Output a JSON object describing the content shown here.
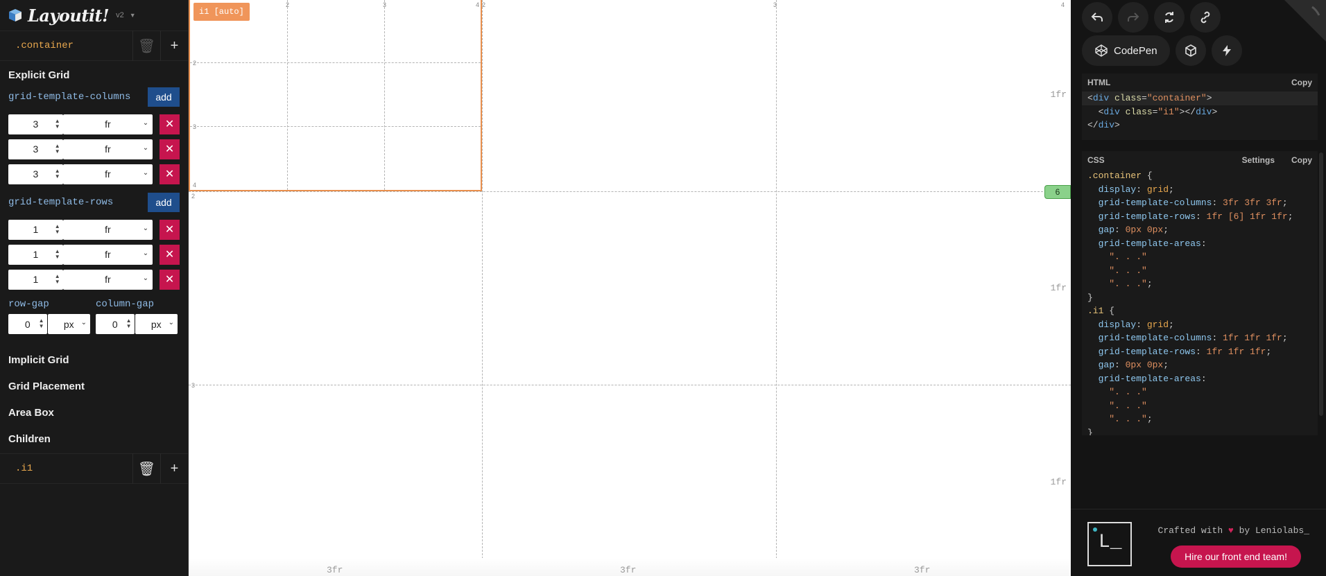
{
  "app": {
    "name": "Layoutit!",
    "version": "v2"
  },
  "sidebar": {
    "container_selector": ".container",
    "explicit_title": "Explicit Grid",
    "columns_label": "grid-template-columns",
    "rows_label": "grid-template-rows",
    "add_label": "add",
    "columns": [
      {
        "value": "3",
        "unit": "fr"
      },
      {
        "value": "3",
        "unit": "fr"
      },
      {
        "value": "3",
        "unit": "fr"
      }
    ],
    "rows": [
      {
        "value": "1",
        "unit": "fr"
      },
      {
        "value": "1",
        "unit": "fr"
      },
      {
        "value": "1",
        "unit": "fr"
      }
    ],
    "row_gap": {
      "label": "row-gap",
      "value": "0",
      "unit": "px"
    },
    "column_gap": {
      "label": "column-gap",
      "value": "0",
      "unit": "px"
    },
    "sections": [
      "Implicit Grid",
      "Grid Placement",
      "Area Box",
      "Children"
    ],
    "child_selector": ".i1",
    "remove_glyph": "✕"
  },
  "canvas": {
    "item_tag": "i1 [auto]",
    "col_labels": [
      "3fr",
      "3fr",
      "3fr"
    ],
    "row_labels": [
      "1fr",
      "1fr",
      "1fr"
    ],
    "badge": "6",
    "outer_col_nums": [
      "2",
      "3",
      "4"
    ],
    "outer_row_nums": [
      "2",
      "3",
      "4"
    ],
    "inner_col_nums": [
      "2",
      "3",
      "4"
    ],
    "inner_row_nums": [
      "2",
      "3",
      "4"
    ]
  },
  "right": {
    "codepen": "CodePen",
    "html_title": "HTML",
    "css_title": "CSS",
    "copy": "Copy",
    "settings": "Settings",
    "crafted": "Crafted with",
    "by": "by Leniolabs_",
    "hire": "Hire our front end team!",
    "logo_letter": "L_"
  }
}
